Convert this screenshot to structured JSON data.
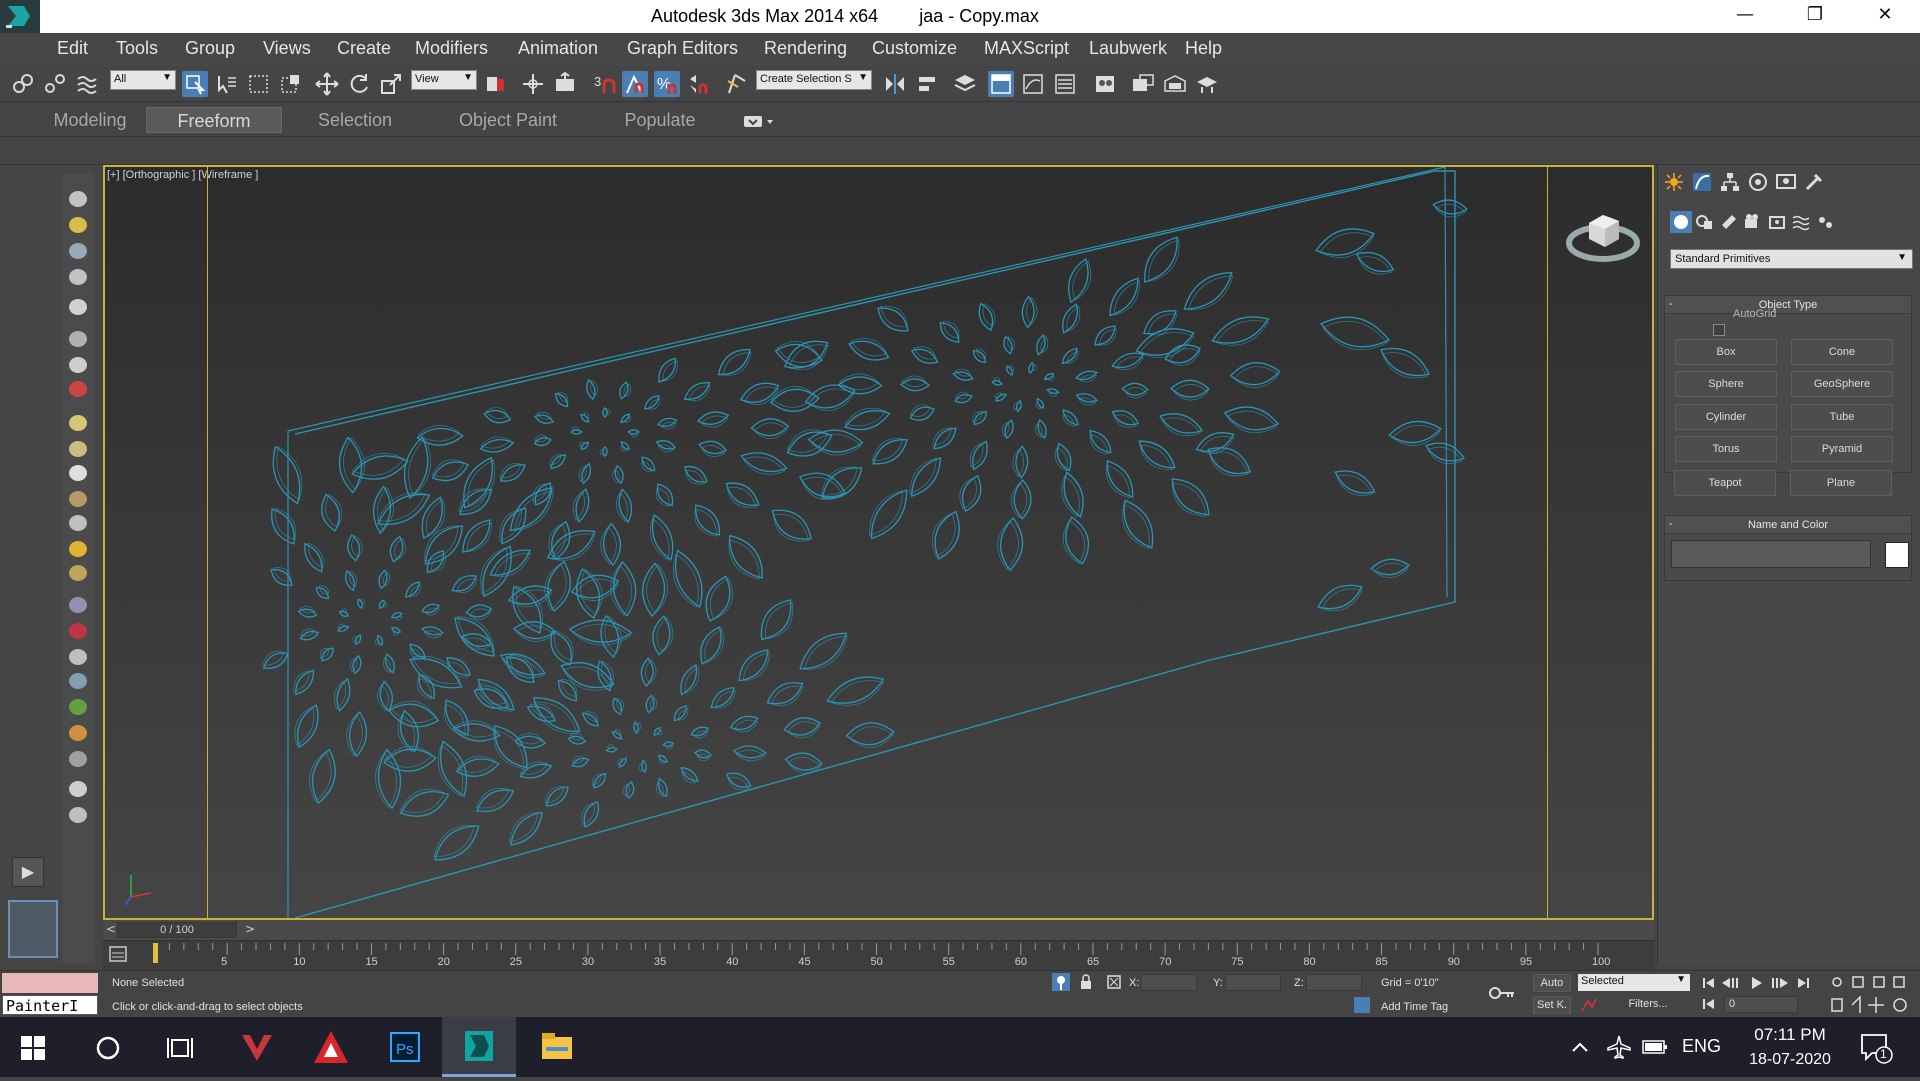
{
  "window": {
    "app_title": "Autodesk 3ds Max  2014 x64",
    "file_title": "jaa - Copy.max"
  },
  "menu": [
    "Edit",
    "Tools",
    "Group",
    "Views",
    "Create",
    "Modifiers",
    "Animation",
    "Graph Editors",
    "Rendering",
    "Customize",
    "MAXScript",
    "Laubwerk",
    "Help"
  ],
  "toolbar": {
    "selection_filter": "All",
    "ref_coord": "View",
    "named_selection": "Create Selection S"
  },
  "ribbon": {
    "tabs": [
      "Modeling",
      "Freeform",
      "Selection",
      "Object Paint",
      "Populate"
    ],
    "active": "Freeform"
  },
  "viewport": {
    "label": "[+] [Orthographic ] [Wireframe ]",
    "wire_color": "#2c94b4"
  },
  "command_panel": {
    "category_dropdown": "Standard Primitives",
    "object_type_title": "Object Type",
    "autogrid_label": "AutoGrid",
    "buttons": [
      "Box",
      "Cone",
      "Sphere",
      "GeoSphere",
      "Cylinder",
      "Tube",
      "Torus",
      "Pyramid",
      "Teapot",
      "Plane"
    ],
    "name_color_title": "Name and Color",
    "object_color": "#ffffff"
  },
  "timeline": {
    "frame_display": "0 / 100",
    "prev": "<",
    "next": ">",
    "ticks": [
      "5",
      "10",
      "15",
      "20",
      "25",
      "30",
      "35",
      "40",
      "45",
      "50",
      "55",
      "60",
      "65",
      "70",
      "75",
      "80",
      "85",
      "90",
      "95",
      "100"
    ]
  },
  "status": {
    "maxscript_listener": "PainterI",
    "selection_status": "None Selected",
    "prompt": "Click or click-and-drag to select objects",
    "x_label": "X:",
    "y_label": "Y:",
    "z_label": "Z:",
    "grid": "Grid = 0'10\"",
    "add_time_tag": "Add Time Tag",
    "auto_key": "Auto",
    "set_key": "Set K.",
    "key_filter": "Selected",
    "filters": "Filters...",
    "current_frame": "0"
  },
  "taskbar": {
    "time": "07:11 PM",
    "date": "18-07-2020",
    "language": "ENG",
    "notifications": "1"
  }
}
